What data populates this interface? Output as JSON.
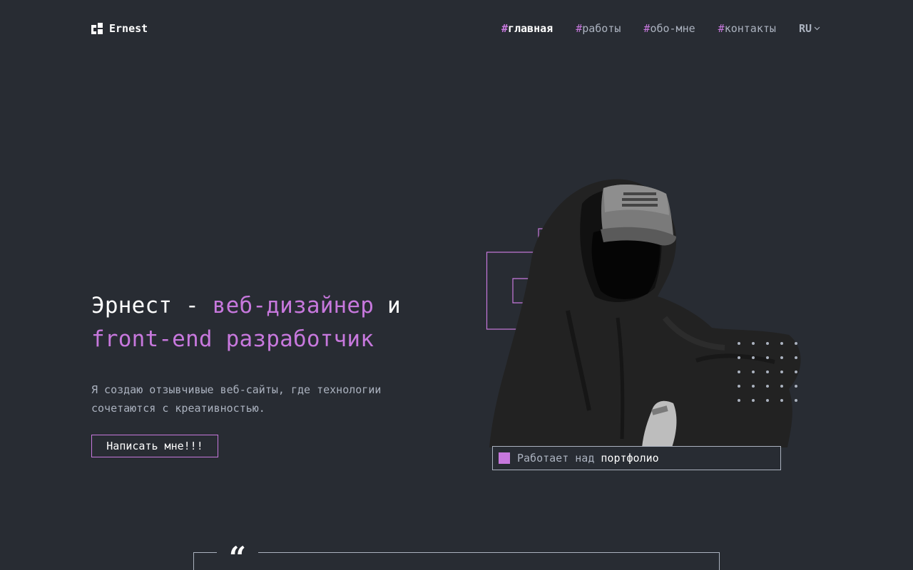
{
  "header": {
    "logo_name": "Ernest",
    "nav": [
      {
        "hash": "#",
        "label": "главная",
        "active": true
      },
      {
        "hash": "#",
        "label": "работы",
        "active": false
      },
      {
        "hash": "#",
        "label": "обо-мне",
        "active": false
      },
      {
        "hash": "#",
        "label": "контакты",
        "active": false
      }
    ],
    "language": "RU"
  },
  "hero": {
    "title_part1": "Эрнест - ",
    "title_accent1": "веб-дизайнер",
    "title_part2": " и ",
    "title_accent2": "front-end разработчик",
    "description": "Я создаю отзывчивые веб-сайты, где технологии сочетаются с креативностью.",
    "cta_label": "Написать мне!!!"
  },
  "status": {
    "prefix": "Работает над ",
    "highlight": "портфолио"
  },
  "quote": {
    "mark": "“"
  },
  "colors": {
    "background": "#282c33",
    "accent": "#c778dd",
    "text": "#ffffff",
    "muted": "#abb2bf"
  }
}
